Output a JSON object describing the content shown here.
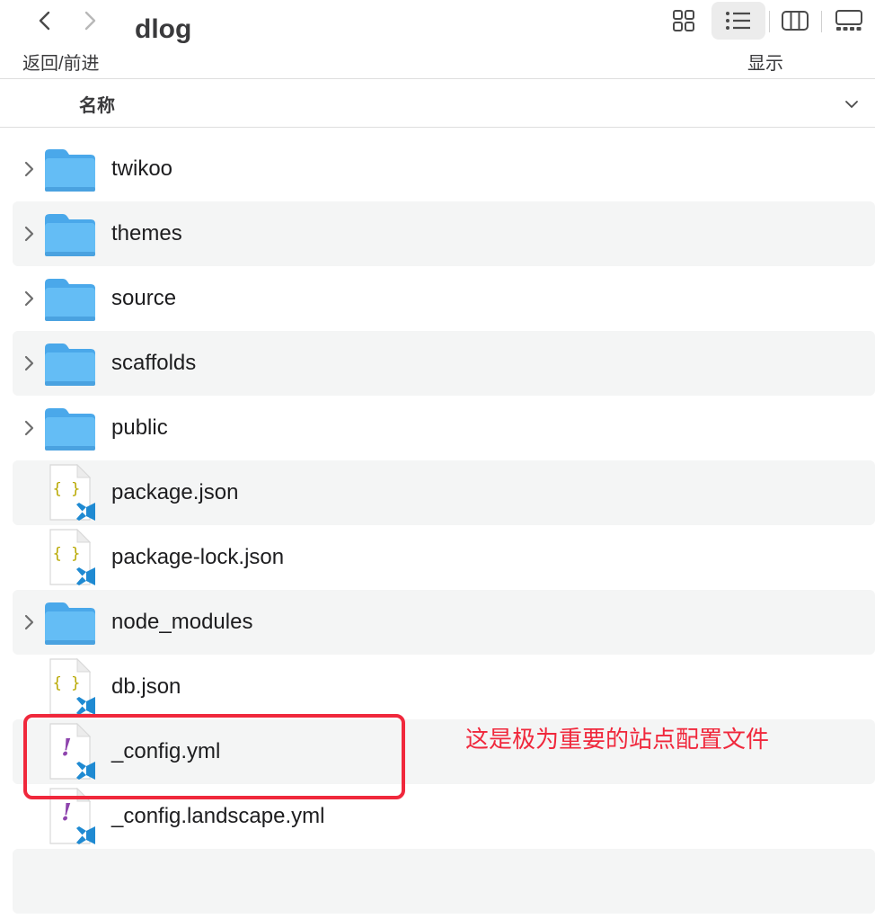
{
  "toolbar": {
    "title": "dlog",
    "nav_label": "返回/前进",
    "view_label": "显示",
    "active_view": "list"
  },
  "header": {
    "name_column": "名称"
  },
  "files": [
    {
      "name": "twikoo",
      "kind": "folder-icon"
    },
    {
      "name": "themes",
      "kind": "folder-icon"
    },
    {
      "name": "source",
      "kind": "folder-icon"
    },
    {
      "name": "scaffolds",
      "kind": "folder-icon"
    },
    {
      "name": "public",
      "kind": "folder-icon"
    },
    {
      "name": "package.json",
      "kind": "json-file-icon"
    },
    {
      "name": "package-lock.json",
      "kind": "json-file-icon"
    },
    {
      "name": "node_modules",
      "kind": "folder-icon"
    },
    {
      "name": "db.json",
      "kind": "json-file-icon"
    },
    {
      "name": "_config.yml",
      "kind": "yaml-file-icon"
    },
    {
      "name": "_config.landscape.yml",
      "kind": "yaml-file-icon"
    }
  ],
  "annotation": {
    "text": "这是极为重要的站点配置文件",
    "color": "#f0283c"
  },
  "colors": {
    "folder": "#5ab4f0",
    "alt_row": "#f4f5f5",
    "json_brace": "#b8a800",
    "yaml_mark": "#8e44ad",
    "vscode_badge": "#1f8ad2"
  }
}
